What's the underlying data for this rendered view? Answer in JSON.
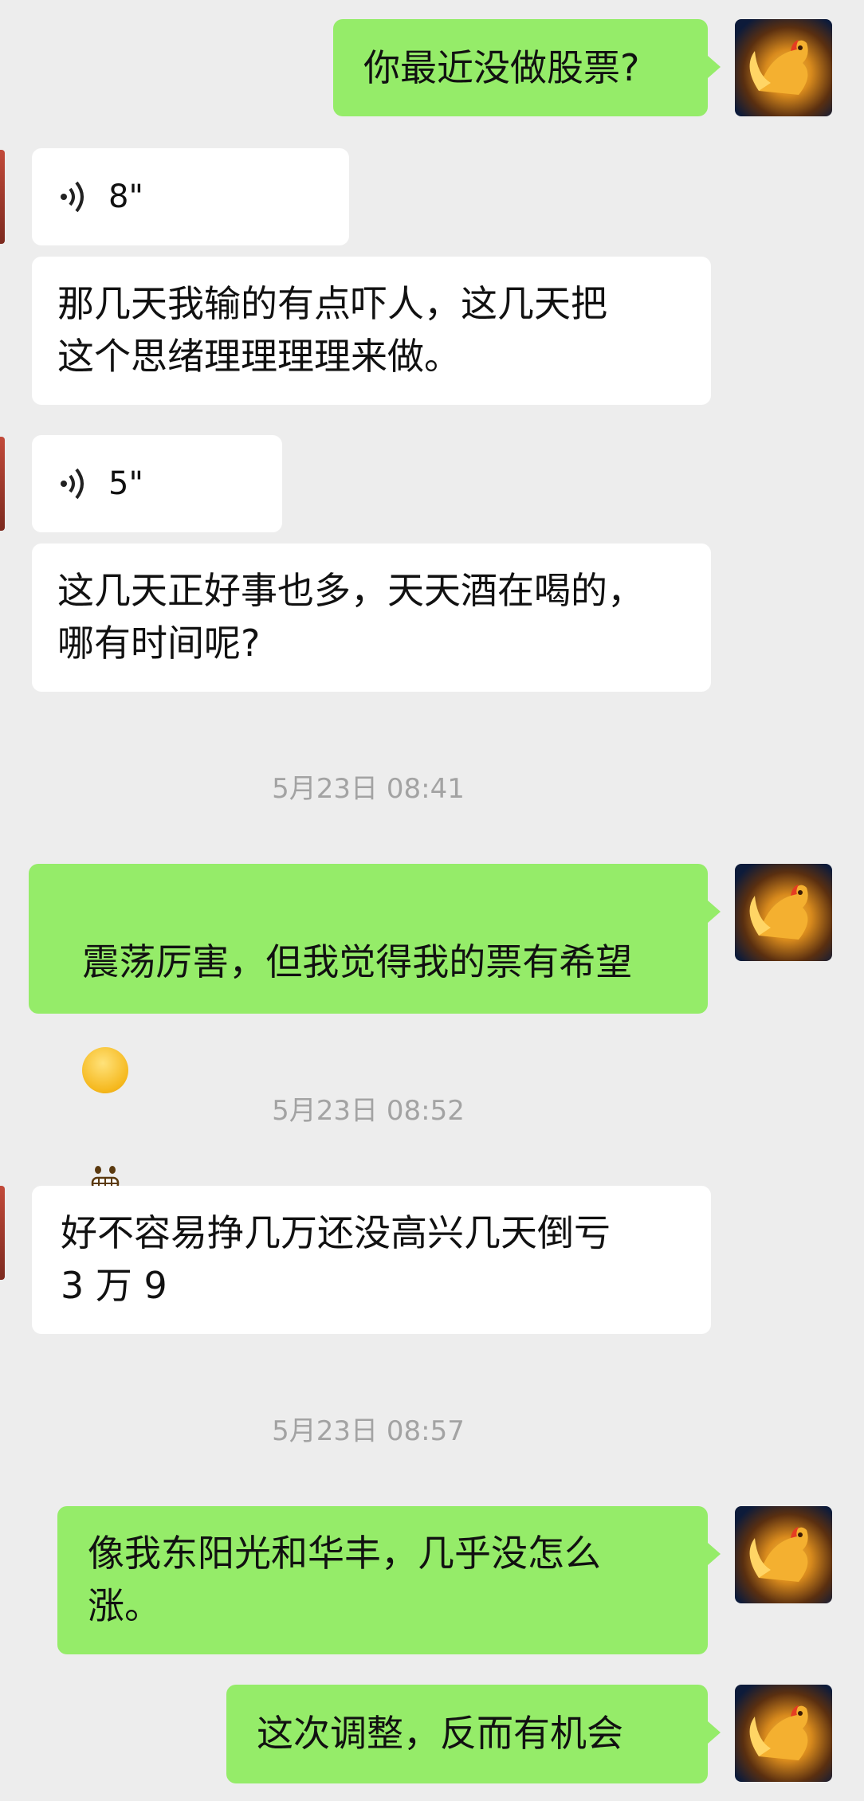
{
  "messages": [
    {
      "side": "right",
      "type": "text",
      "text": "你最近没做股票?"
    },
    {
      "side": "left",
      "type": "voice",
      "duration": "8\""
    },
    {
      "side": "left",
      "type": "text",
      "text": "那几天我输的有点吓人，这几天把\n这个思绪理理理理来做。"
    },
    {
      "side": "left",
      "type": "voice",
      "duration": "5\""
    },
    {
      "side": "left",
      "type": "text",
      "text": "这几天正好事也多，天天酒在喝的，\n哪有时间呢?"
    },
    {
      "type": "timestamp",
      "text": "5月23日 08:41"
    },
    {
      "side": "right",
      "type": "text",
      "text": "震荡厉害，但我觉得我的票有希望"
    },
    {
      "type": "timestamp",
      "text": "5月23日 08:52"
    },
    {
      "side": "left",
      "type": "text",
      "text": "好不容易挣几万还没高兴几天倒亏\n3 万 9"
    },
    {
      "type": "timestamp",
      "text": "5月23日 08:57"
    },
    {
      "side": "right",
      "type": "text",
      "text": "像我东阳光和华丰，几乎没怎么\n涨。"
    },
    {
      "side": "right",
      "type": "text",
      "text": "这次调整，反而有机会"
    }
  ],
  "icons": {
    "avatar": "golden-rooster-avatar",
    "voice": "voice-wave-icon",
    "emoji": "grinning-emoji"
  }
}
